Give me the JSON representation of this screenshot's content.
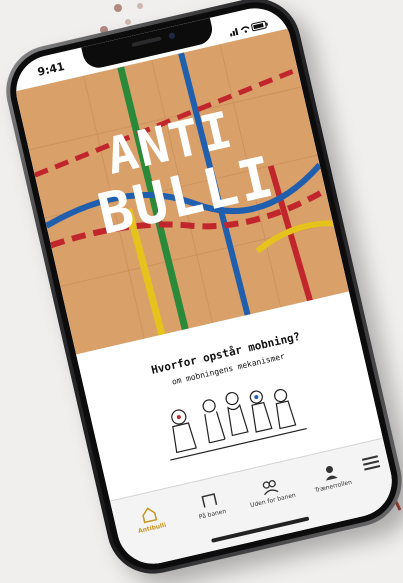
{
  "status_bar": {
    "time": "9:41"
  },
  "hero": {
    "logo_line1": "ANTI",
    "logo_line2": "BULLI"
  },
  "content": {
    "headline": "Hvorfor opstår mobning?",
    "subline": "om mobningens mekanismer"
  },
  "tabs": [
    {
      "label": "Antibulli",
      "icon": "home-icon",
      "active": true
    },
    {
      "label": "På banen",
      "icon": "goal-icon",
      "active": false
    },
    {
      "label": "Uden for banen",
      "icon": "group-icon",
      "active": false
    },
    {
      "label": "Trænerrollen",
      "icon": "coach-icon",
      "active": false
    }
  ],
  "menu": {
    "icon": "hamburger-icon"
  },
  "colors": {
    "wood": "#d9a06a",
    "line_blue": "#1f5fae",
    "line_red": "#c0262c",
    "line_green": "#2a8a3a",
    "line_yellow": "#e6c21c",
    "active_tab": "#c8951e"
  }
}
